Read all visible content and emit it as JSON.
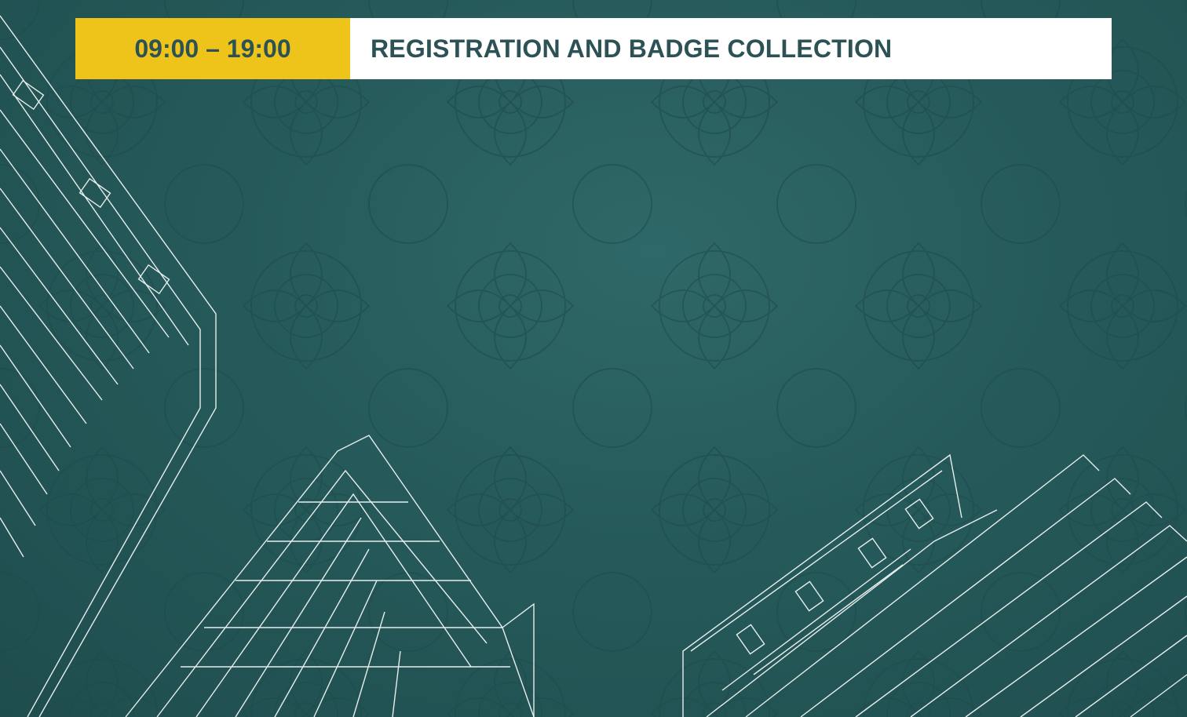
{
  "schedule": {
    "time": "09:00 – 19:00",
    "event": "REGISTRATION AND BADGE COLLECTION"
  },
  "colors": {
    "background": "#265a5a",
    "time_bg": "#eec41b",
    "event_bg": "#ffffff",
    "text": "#2d5255",
    "lines": "#ffffff"
  }
}
